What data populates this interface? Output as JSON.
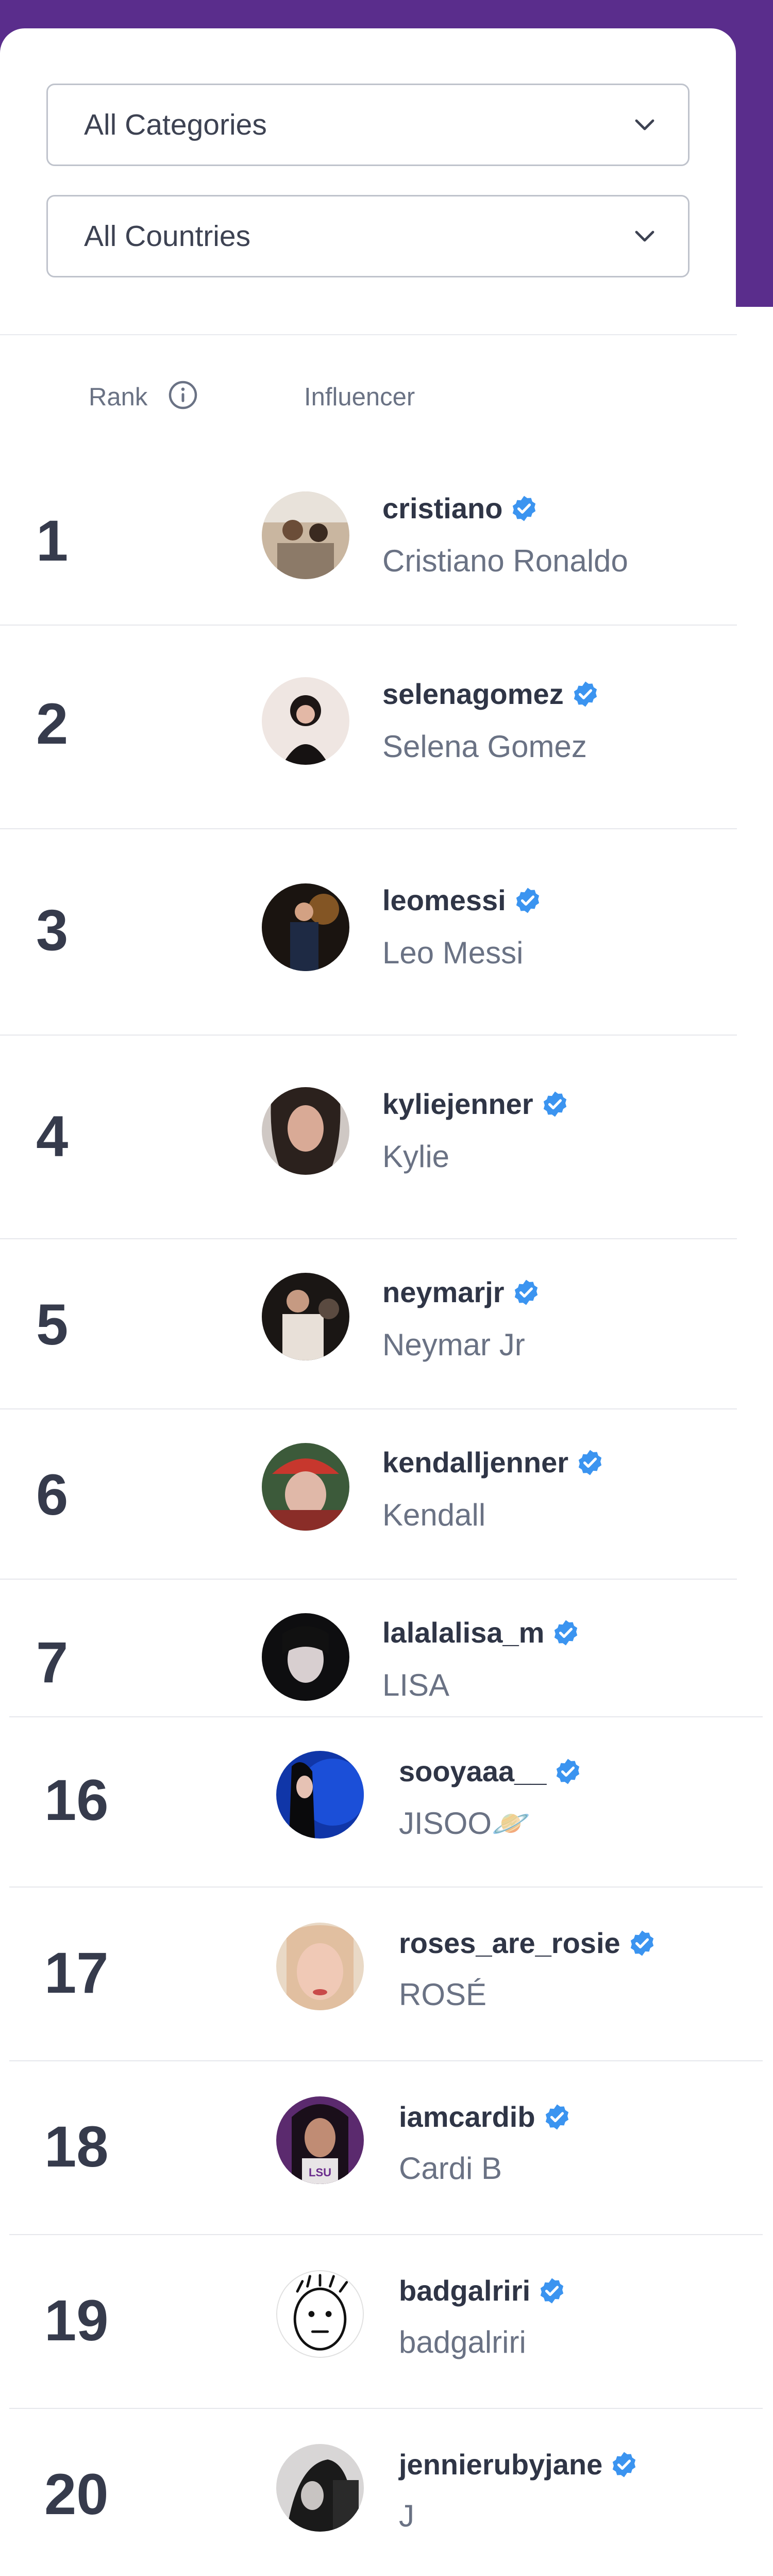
{
  "filters": {
    "categories": {
      "value": "All Categories"
    },
    "countries": {
      "value": "All Countries"
    }
  },
  "table": {
    "headers": {
      "rank": "Rank",
      "influencer": "Influencer"
    },
    "info_icon": "info-icon",
    "verified_icon": "verified-badge-icon",
    "rows": [
      {
        "rank": "1",
        "username": "cristiano",
        "name": "Cristiano Ronaldo"
      },
      {
        "rank": "2",
        "username": "selenagomez",
        "name": "Selena Gomez"
      },
      {
        "rank": "3",
        "username": "leomessi",
        "name": "Leo Messi"
      },
      {
        "rank": "4",
        "username": "kyliejenner",
        "name": "Kylie"
      },
      {
        "rank": "5",
        "username": "neymarjr",
        "name": "Neymar Jr"
      },
      {
        "rank": "6",
        "username": "kendalljenner",
        "name": "Kendall"
      },
      {
        "rank": "7",
        "username": "lalalalisa_m",
        "name": "LISA"
      },
      {
        "rank": "16",
        "username": "sooyaaa__",
        "name": "JISOO🪐"
      },
      {
        "rank": "17",
        "username": "roses_are_rosie",
        "name": "ROSÉ"
      },
      {
        "rank": "18",
        "username": "iamcardib",
        "name": "Cardi B"
      },
      {
        "rank": "19",
        "username": "badgalriri",
        "name": "badgalriri"
      },
      {
        "rank": "20",
        "username": "jennierubyjane",
        "name": "J"
      }
    ]
  },
  "colors": {
    "header_purple": "#5a2d8c",
    "verified_blue": "#3b94f0"
  }
}
